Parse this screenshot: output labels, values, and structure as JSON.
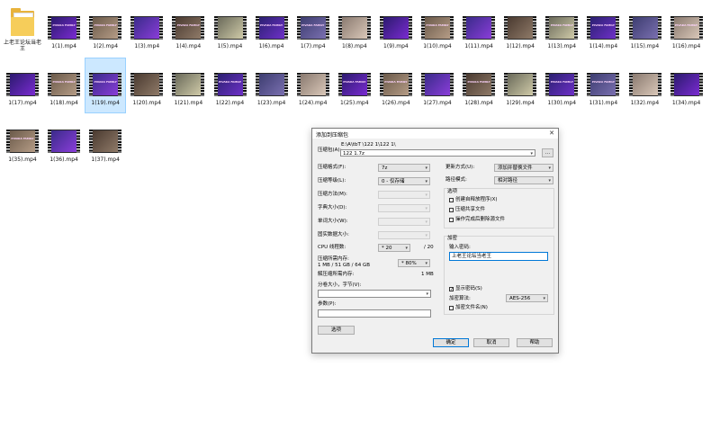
{
  "explorer": {
    "folder": {
      "label": "上老王论坛当老王"
    },
    "files": [
      "1(1).mp4",
      "1(2).mp4",
      "1(3).mp4",
      "1(4).mp4",
      "1(5).mp4",
      "1(6).mp4",
      "1(7).mp4",
      "1(8).mp4",
      "1(9).mp4",
      "1(10).mp4",
      "1(11).mp4",
      "1(12).mp4",
      "1(13).mp4",
      "1(14).mp4",
      "1(15).mp4",
      "1(16).mp4",
      "1(17).mp4",
      "1(18).mp4",
      "1(19).mp4",
      "1(20).mp4",
      "1(21).mp4",
      "1(22).mp4",
      "1(23).mp4",
      "1(24).mp4",
      "1(25).mp4",
      "1(26).mp4",
      "1(27).mp4",
      "1(28).mp4",
      "1(29).mp4",
      "1(30).mp4",
      "1(31).mp4",
      "1(32).mp4",
      "1(34).mp4",
      "1(35).mp4",
      "1(36).mp4",
      "1(37).mp4"
    ],
    "selected_index": 2,
    "thumb_caption": "PIVAKA FAMILY"
  },
  "dialog": {
    "title": "添加到压缩包",
    "close": "✕",
    "archive_label": "压缩包(A):",
    "archive_path": "E:\\A\\tbT \\122 1\\122 1\\",
    "archive_name": "122 1.7z",
    "browse": "...",
    "left": {
      "format_label": "压缩格式(F):",
      "format_value": "7z",
      "level_label": "压缩等级(L):",
      "level_value": "0 - 仅存储",
      "method_label": "压缩方法(M):",
      "dict_label": "字典大小(D):",
      "word_label": "单词大小(W):",
      "solid_label": "固实数据大小:",
      "cpu_label": "CPU 线程数:",
      "cpu_value": "* 20",
      "cpu_max": "/ 20",
      "mem_label": "压缩所需内存:",
      "mem_value": "1 MB / 51 GB / 64 GB",
      "mem_pct": "* 80%",
      "decomp_label": "解压缩所需内存:",
      "decomp_value": "1 MB",
      "split_label": "分卷大小，字节(V):",
      "params_label": "参数(P):",
      "options_btn": "选项"
    },
    "right": {
      "update_label": "更新方式(U):",
      "update_value": "添加并替换文件",
      "pathmode_label": "路径模式:",
      "pathmode_value": "相对路径",
      "options_title": "选项",
      "opt_sfx": "创建自释放程序(X)",
      "opt_shared": "压缩共享文件",
      "opt_delete": "操作完成后删除源文件",
      "encrypt_title": "加密",
      "pw_label": "输入密码:",
      "pw_value": "上老王论坛当老王",
      "show_pw": "显示密码(S)",
      "method_label": "加密算法:",
      "method_value": "AES-256",
      "encrypt_names": "加密文件名(N)"
    },
    "buttons": {
      "ok": "确定",
      "cancel": "取消",
      "help": "帮助"
    }
  }
}
